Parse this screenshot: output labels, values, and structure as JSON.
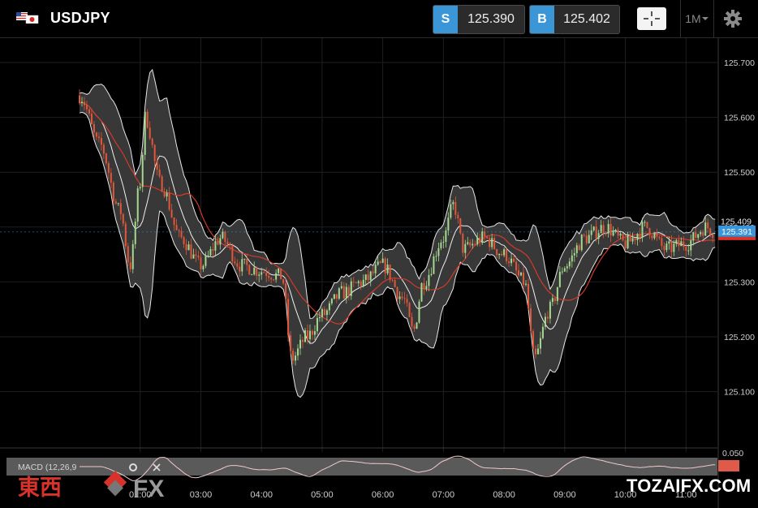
{
  "header": {
    "symbol": "USDJPY",
    "sell_tag": "S",
    "sell_price": "125.390",
    "buy_tag": "B",
    "buy_price": "125.402",
    "timeframe": "1M"
  },
  "price_axis": {
    "labels": [
      "125.700",
      "125.600",
      "125.500",
      "125.400",
      "125.300",
      "125.200",
      "125.100"
    ],
    "bid_marker": "125.391",
    "ask_marker": "125.409"
  },
  "macd_panel": {
    "label": "MACD (12,26,9",
    "axis_label": "0.050"
  },
  "time_axis": {
    "labels": [
      "02:00",
      "03:00",
      "04:00",
      "05:00",
      "06:00",
      "07:00",
      "08:00",
      "09:00",
      "10:00",
      "11:00"
    ]
  },
  "watermarks": {
    "left_cjk": "東西",
    "left_fx": "FX",
    "right": "TOZAIFX.COM"
  },
  "colors": {
    "up_candle": "#a6d98f",
    "down_candle": "#e0573a",
    "band_fill": "#3b3b3b",
    "ma_line": "#d23a2a",
    "accent_blue": "#3a96d6"
  },
  "chart_data": {
    "type": "candlestick",
    "symbol": "USDJPY",
    "timeframe": "1M",
    "ylim": [
      125.05,
      125.75
    ],
    "y_ticks": [
      125.1,
      125.2,
      125.3,
      125.4,
      125.5,
      125.6,
      125.7
    ],
    "x_ticks": [
      "02:00",
      "03:00",
      "04:00",
      "05:00",
      "06:00",
      "07:00",
      "08:00",
      "09:00",
      "10:00",
      "11:00"
    ],
    "mid_price_path": [
      [
        "01:00",
        125.64
      ],
      [
        "01:20",
        125.55
      ],
      [
        "01:40",
        125.43
      ],
      [
        "01:50",
        125.33
      ],
      [
        "02:00",
        125.48
      ],
      [
        "02:05",
        125.6
      ],
      [
        "02:20",
        125.48
      ],
      [
        "02:40",
        125.38
      ],
      [
        "03:00",
        125.33
      ],
      [
        "03:20",
        125.38
      ],
      [
        "03:40",
        125.33
      ],
      [
        "04:00",
        125.32
      ],
      [
        "04:20",
        125.31
      ],
      [
        "04:30",
        125.16
      ],
      [
        "04:45",
        125.2
      ],
      [
        "05:00",
        125.24
      ],
      [
        "05:20",
        125.28
      ],
      [
        "05:40",
        125.3
      ],
      [
        "06:00",
        125.33
      ],
      [
        "06:20",
        125.27
      ],
      [
        "06:30",
        125.21
      ],
      [
        "06:40",
        125.3
      ],
      [
        "07:00",
        125.38
      ],
      [
        "07:10",
        125.44
      ],
      [
        "07:20",
        125.36
      ],
      [
        "07:40",
        125.38
      ],
      [
        "08:00",
        125.35
      ],
      [
        "08:20",
        125.3
      ],
      [
        "08:30",
        125.16
      ],
      [
        "08:45",
        125.25
      ],
      [
        "09:00",
        125.33
      ],
      [
        "09:20",
        125.38
      ],
      [
        "09:40",
        125.4
      ],
      [
        "10:00",
        125.37
      ],
      [
        "10:20",
        125.4
      ],
      [
        "10:40",
        125.36
      ],
      [
        "11:00",
        125.37
      ],
      [
        "11:20",
        125.4
      ],
      [
        "11:30",
        125.39
      ]
    ]
  }
}
